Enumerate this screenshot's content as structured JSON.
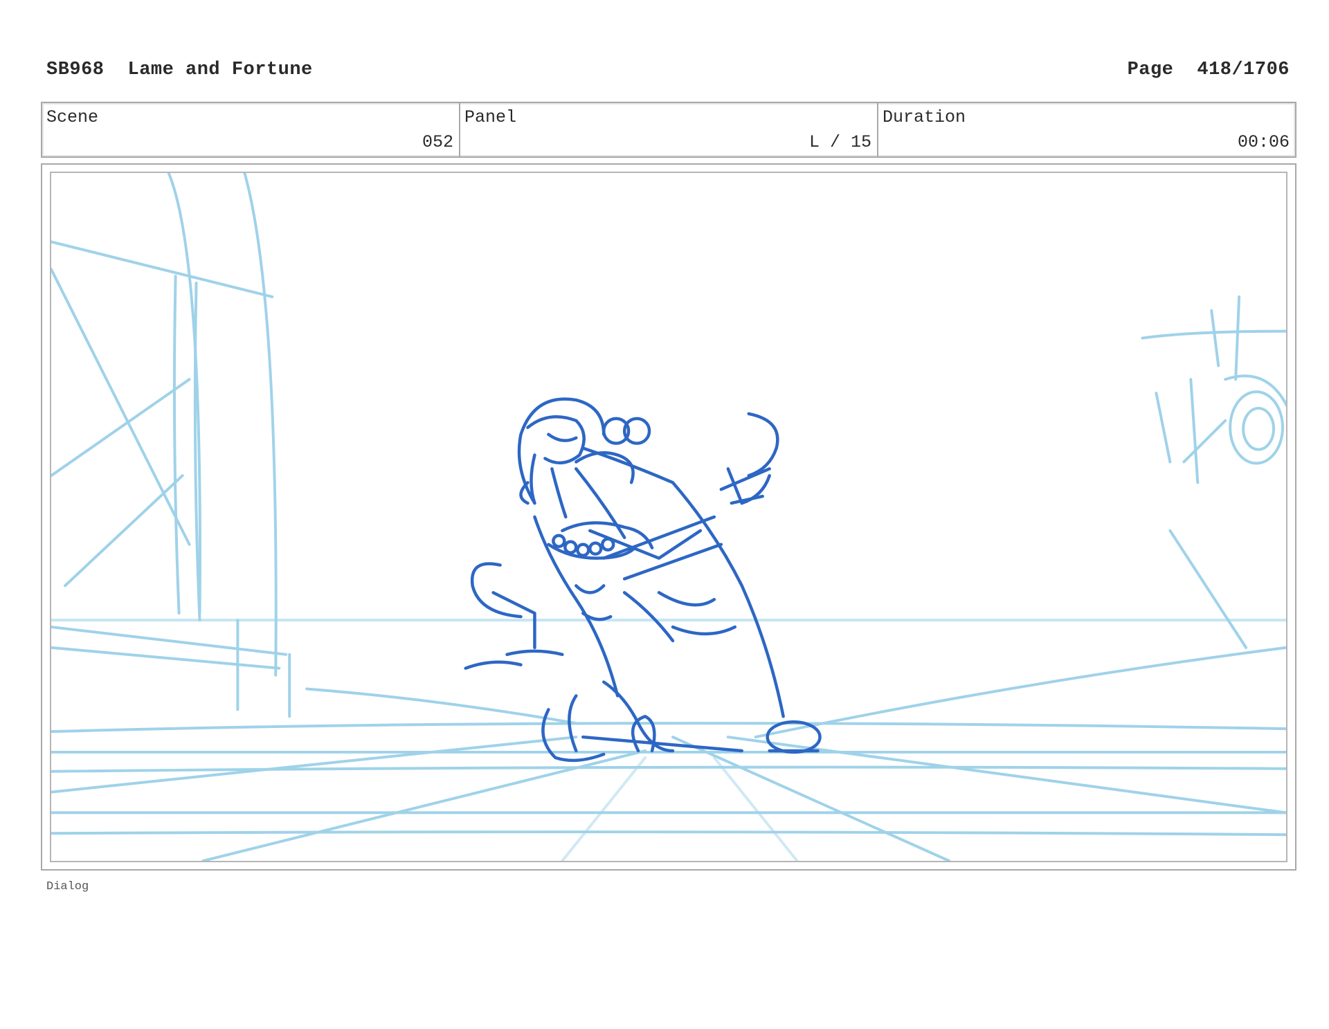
{
  "header": {
    "code": "SB968",
    "title": "Lame and Fortune",
    "page_label": "Page",
    "page_value": "418/1706"
  },
  "info": {
    "scene_label": "Scene",
    "scene_value": "052",
    "panel_label": "Panel",
    "panel_value": "L / 15",
    "duration_label": "Duration",
    "duration_value": "00:06"
  },
  "drawing": {
    "layout_color": "#8fcbe6",
    "character_color": "#2d67c4"
  },
  "footer": {
    "dialog_label": "Dialog"
  }
}
